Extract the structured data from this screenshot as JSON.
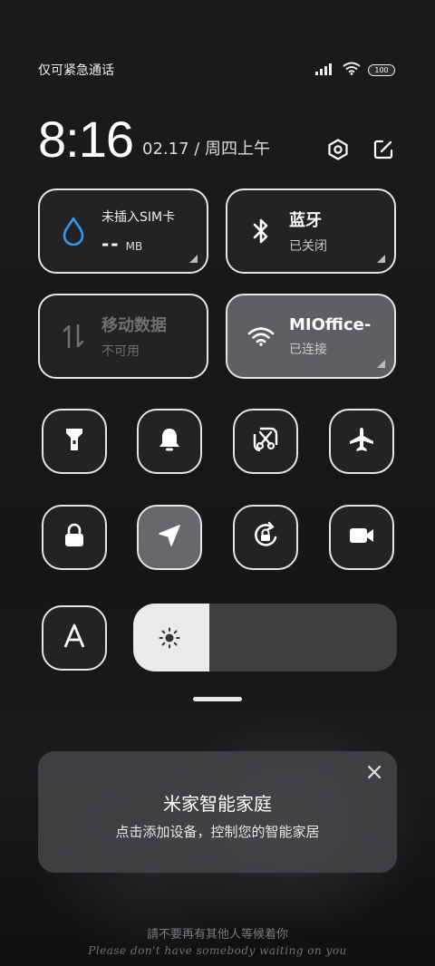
{
  "status_bar": {
    "carrier_text": "仅可紧急通话",
    "battery_level": "100"
  },
  "header": {
    "time": "8:16",
    "date": "02.17 / 周四上午",
    "settings_icon": "settings-hexagon-icon",
    "edit_icon": "edit-icon"
  },
  "tiles": {
    "sim": {
      "title": "未插入SIM卡",
      "value": "--",
      "unit": "MB",
      "icon": "water-drop-icon",
      "accent": "#2f9bf0"
    },
    "bluetooth": {
      "title": "蓝牙",
      "status": "已关闭",
      "icon": "bluetooth-icon"
    },
    "mobile_data": {
      "title": "移动数据",
      "status": "不可用",
      "icon": "data-arrows-icon"
    },
    "wifi": {
      "title": "MIOffice-",
      "status": "已连接",
      "icon": "wifi-icon"
    }
  },
  "toggles": [
    {
      "name": "flashlight",
      "icon": "flashlight-icon",
      "active": false
    },
    {
      "name": "mute",
      "icon": "bell-icon",
      "active": false
    },
    {
      "name": "screenshot",
      "icon": "scissors-icon",
      "active": false
    },
    {
      "name": "airplane-mode",
      "icon": "airplane-icon",
      "active": false
    },
    {
      "name": "lock-screen",
      "icon": "lock-icon",
      "active": false
    },
    {
      "name": "location",
      "icon": "location-arrow-icon",
      "active": true
    },
    {
      "name": "rotation-lock",
      "icon": "rotation-lock-icon",
      "active": false
    },
    {
      "name": "screen-record",
      "icon": "video-camera-icon",
      "active": false
    },
    {
      "name": "auto-brightness",
      "icon": "letter-a-icon",
      "active": false
    }
  ],
  "brightness": {
    "level": 0.29,
    "icon": "sun-icon"
  },
  "smart_home_card": {
    "title": "米家智能家庭",
    "subtitle": "点击添加设备，控制您的智能家居"
  },
  "wallpaper": {
    "quote_cn": "請不要再有其他人等候着你",
    "quote_en": "Please don't have somebody waiting on you"
  },
  "colors": {
    "tile_border": "#e6e6e6",
    "tile_dark": "#232325",
    "tile_active": "#5f5f63",
    "accent_blue": "#2f9bf0"
  }
}
